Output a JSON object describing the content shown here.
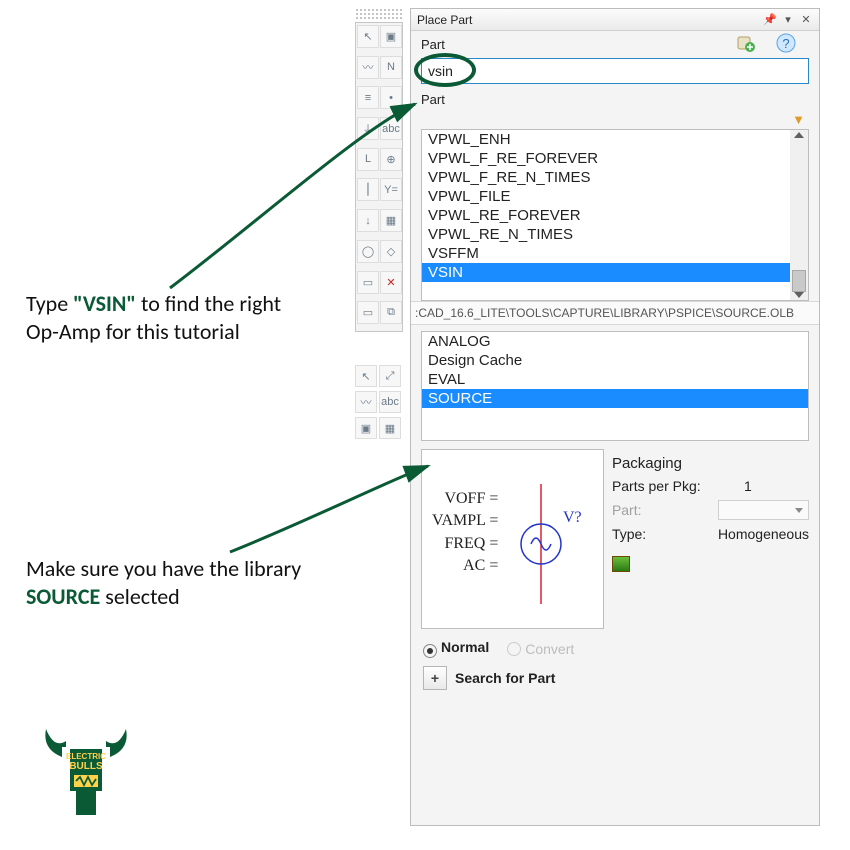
{
  "annotations": {
    "top": {
      "pre": "Type ",
      "kw": "\"VSIN\"",
      "post": " to find the right Op-Amp for this tutorial"
    },
    "bottom": {
      "pre": "Make sure you have the library ",
      "kw": "SOURCE",
      "post": " selected"
    }
  },
  "panel": {
    "title": "Place Part",
    "part_section_label": "Part",
    "part_input_value": "vsin",
    "part_list_label": "Part",
    "parts": [
      "VPWL_ENH",
      "VPWL_F_RE_FOREVER",
      "VPWL_F_RE_N_TIMES",
      "VPWL_FILE",
      "VPWL_RE_FOREVER",
      "VPWL_RE_N_TIMES",
      "VSFFM",
      "VSIN"
    ],
    "parts_selected_index": 7,
    "path_bar": ":CAD_16.6_LITE\\TOOLS\\CAPTURE\\LIBRARY\\PSPICE\\SOURCE.OLB",
    "libraries": [
      "ANALOG",
      "Design Cache",
      "EVAL",
      "SOURCE"
    ],
    "libraries_selected_index": 3,
    "preview_params": [
      "VOFF =",
      "VAMPL =",
      "FREQ =",
      "AC ="
    ],
    "preview_symbol_label": "V?",
    "packaging": {
      "title": "Packaging",
      "parts_per_pkg_label": "Parts per Pkg:",
      "parts_per_pkg_value": "1",
      "part_label": "Part:",
      "type_label": "Type:",
      "type_value": "Homogeneous"
    },
    "radios": {
      "normal": "Normal",
      "convert": "Convert"
    },
    "search_label": "Search for Part",
    "plus_label": "+"
  },
  "logo": {
    "top": "ELECTRIC",
    "bottom": "BULLS"
  }
}
